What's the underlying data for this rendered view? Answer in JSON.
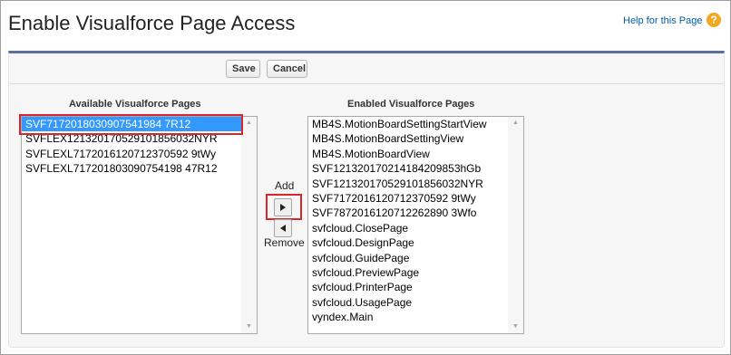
{
  "page": {
    "title": "Enable Visualforce Page Access",
    "help_link": "Help for this Page",
    "help_icon": "?"
  },
  "toolbar": {
    "save_label": "Save",
    "cancel_label": "Cancel"
  },
  "available": {
    "header": "Available Visualforce Pages",
    "items": [
      "SVF7172018030907541984 7R12",
      "SVFLEX121320170529101856032NYR",
      "SVFLEXL7172016120712370592 9tWy",
      "SVFLEXL717201803090754198 47R12"
    ],
    "selected_index": 0
  },
  "enabled": {
    "header": "Enabled Visualforce Pages",
    "items": [
      "MB4S.MotionBoardSettingStartView",
      "MB4S.MotionBoardSettingView",
      "MB4S.MotionBoardView",
      "SVF121320170214184209853hGb",
      "SVF121320170529101856032NYR",
      "SVF7172016120712370592 9tWy",
      "SVF7872016120712262890 3Wfo",
      "svfcloud.ClosePage",
      "svfcloud.DesignPage",
      "svfcloud.GuidePage",
      "svfcloud.PreviewPage",
      "svfcloud.PrinterPage",
      "svfcloud.UsagePage",
      "vyndex.Main"
    ]
  },
  "controls": {
    "add_label": "Add",
    "remove_label": "Remove"
  },
  "colors": {
    "accent_border": "#5c6f9a",
    "selection": "#3399ff",
    "highlight": "#d8262a",
    "link": "#015ba7",
    "help_icon": "#f3a823"
  },
  "icons": {
    "add": "triangle-right-icon",
    "remove": "triangle-left-icon",
    "scroll_up": "scroll-up-icon",
    "scroll_down": "scroll-down-icon"
  }
}
